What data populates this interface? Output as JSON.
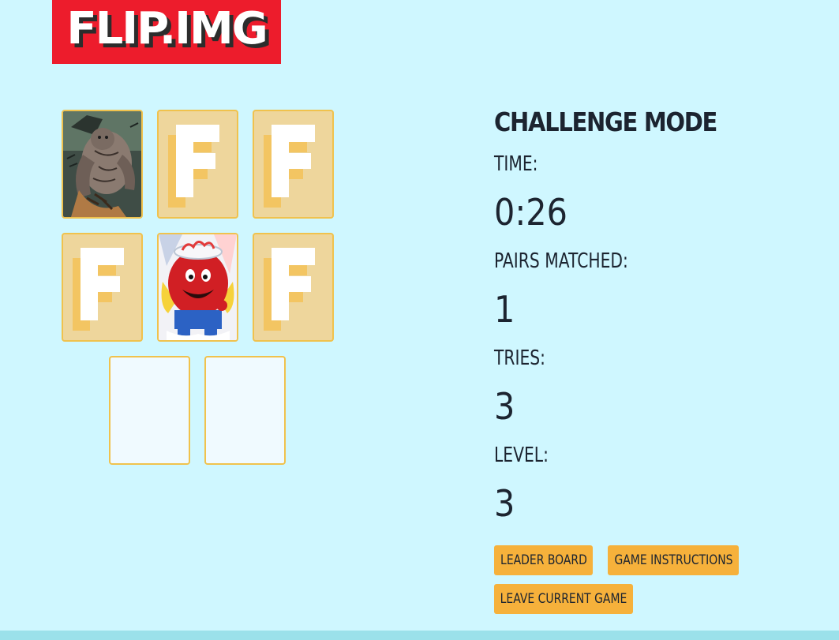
{
  "logo": {
    "text": "FLIP.IMG",
    "bg": "#ed1c2c"
  },
  "board": {
    "cards": [
      {
        "state": "face",
        "image": "hulk-creature-art"
      },
      {
        "state": "back",
        "letter": "F"
      },
      {
        "state": "back",
        "letter": "F"
      },
      {
        "state": "back",
        "letter": "F"
      },
      {
        "state": "face",
        "image": "kool-aid-man-art"
      },
      {
        "state": "back",
        "letter": "F"
      },
      {
        "state": "empty"
      },
      {
        "state": "empty"
      }
    ]
  },
  "stats": {
    "mode_title": "CHALLENGE MODE",
    "time_label": "TIME:",
    "time_value": "0:26",
    "pairs_label": "PAIRS MATCHED:",
    "pairs_value": "1",
    "tries_label": "TRIES:",
    "tries_value": "3",
    "level_label": "LEVEL:",
    "level_value": "3"
  },
  "buttons": {
    "leaderboard": "LEADER BOARD",
    "instructions": "GAME INSTRUCTIONS",
    "leave": "LEAVE CURRENT GAME"
  },
  "colors": {
    "background": "#cff7ff",
    "card_back": "#eed69c",
    "card_border": "#f0c24d",
    "button": "#f6b13b"
  }
}
